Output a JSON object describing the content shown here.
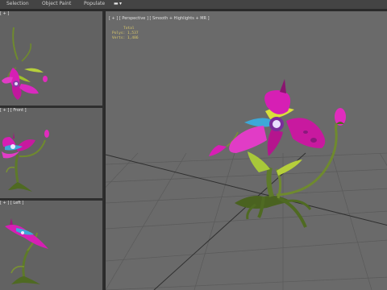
{
  "menubar": {
    "items": [
      "Selection",
      "Object Paint",
      "Populate"
    ],
    "extra_icon": "camera-icon",
    "extra_label": "▾"
  },
  "viewport": {
    "header": "[ + ] [ Perspective ] [ Smooth + Highlights + MR ]",
    "hud": {
      "total_label": "Total",
      "polys_label": "Polys:",
      "polys_value": "1,537",
      "verts_label": "Verts:",
      "verts_value": "1,486"
    }
  },
  "panels": [
    {
      "title": "[ + ]"
    },
    {
      "title": "[ + ] [ Front ]"
    },
    {
      "title": "[ + ] [ Left ]"
    }
  ],
  "colors": {
    "petal": "#d61fb4",
    "stem": "#5e7a2a",
    "grid": "#555555",
    "hud_text": "#d9c86a"
  }
}
